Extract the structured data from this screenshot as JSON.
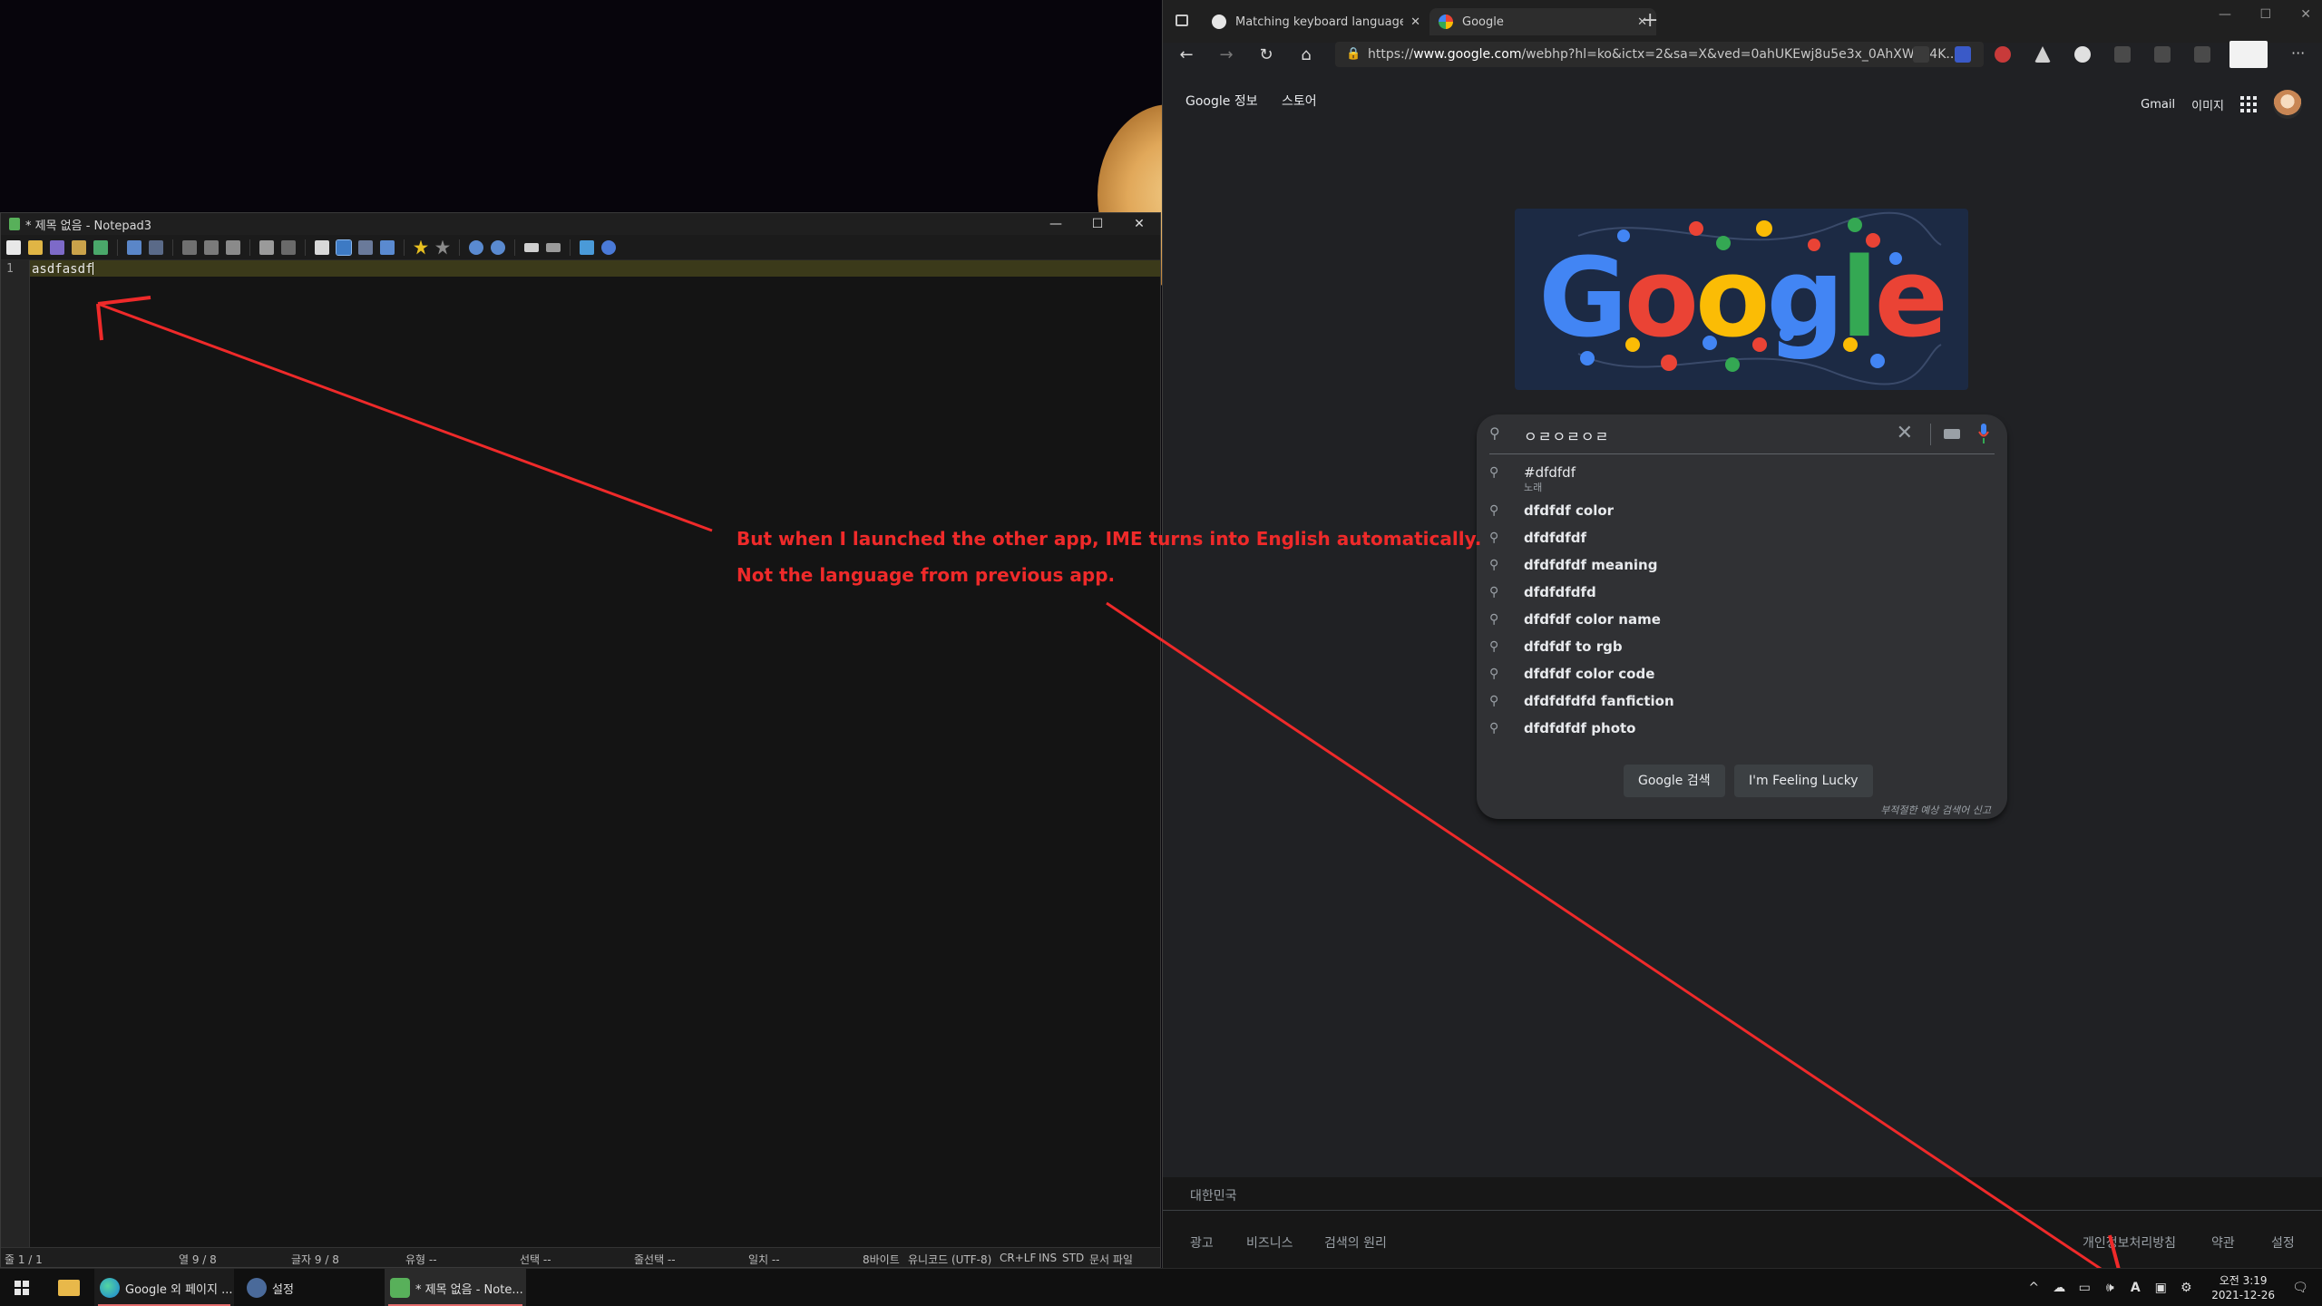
{
  "notepad": {
    "title": "* 제목 없음 - Notepad3",
    "line_number": "1",
    "content": "asdfasdf",
    "minimize": "—",
    "maximize": "☐",
    "close": "✕",
    "status": {
      "line": "줄 1 / 1",
      "col": "열 9 / 8",
      "char": "글자 9 / 8",
      "type": "유형 --",
      "sel": "선택 --",
      "sel_lines": "줄선택 --",
      "match": "일치 --",
      "bytes": "8바이트",
      "encoding": "유니코드 (UTF-8)",
      "eol": "CR+LF",
      "ins": "INS",
      "std": "STD",
      "doc": "문서 파일"
    }
  },
  "browser": {
    "tabs": [
      {
        "label": "Matching keyboard language to",
        "icon": "github-icon"
      },
      {
        "label": "Google",
        "icon": "google-icon"
      }
    ],
    "new_tab": "+",
    "url_prefix": "https://",
    "url_host": "www.google.com",
    "url_rest": "/webhp?hl=ko&ictx=2&sa=X&ved=0ahUKEwj8u5e3x_0AhXWa94K...",
    "google": {
      "top_left": [
        "Google 정보",
        "스토어"
      ],
      "gmail": "Gmail",
      "images": "이미지",
      "search_value": "ㅇㄹㅇㄹㅇㄹ",
      "suggestions": [
        {
          "text": "#dfdfdf",
          "sub": "노래"
        },
        {
          "text": "dfdfdf color"
        },
        {
          "text": "dfdfdfdf"
        },
        {
          "text": "dfdfdfdf meaning"
        },
        {
          "text": "dfdfdfdfd"
        },
        {
          "text": "dfdfdf color name"
        },
        {
          "text": "dfdfdf to rgb"
        },
        {
          "text": "dfdfdf color code"
        },
        {
          "text": "dfdfdfdfd fanfiction"
        },
        {
          "text": "dfdfdfdf photo"
        }
      ],
      "search_button": "Google 검색",
      "lucky_button": "I'm Feeling Lucky",
      "report": "부적절한 예상 검색어 신고",
      "country": "대한민국",
      "footer_left": [
        "광고",
        "비즈니스",
        "검색의 원리"
      ],
      "footer_right": [
        "개인정보처리방침",
        "약관",
        "설정"
      ]
    }
  },
  "annotation": {
    "line1": "But when I launched the other app, IME turns into English automatically.",
    "line2": "Not the language from previous app.",
    "color": "#ef2a2a"
  },
  "taskbar": {
    "apps": [
      {
        "label": "Google 외 페이지 ...",
        "icon": "edge-icon"
      },
      {
        "label": "설정",
        "icon": "settings-icon"
      },
      {
        "label": "* 제목 없음 - Note...",
        "icon": "notepad3-icon"
      }
    ],
    "ime": "A",
    "time": "오전 3:19",
    "date": "2021-12-26"
  }
}
